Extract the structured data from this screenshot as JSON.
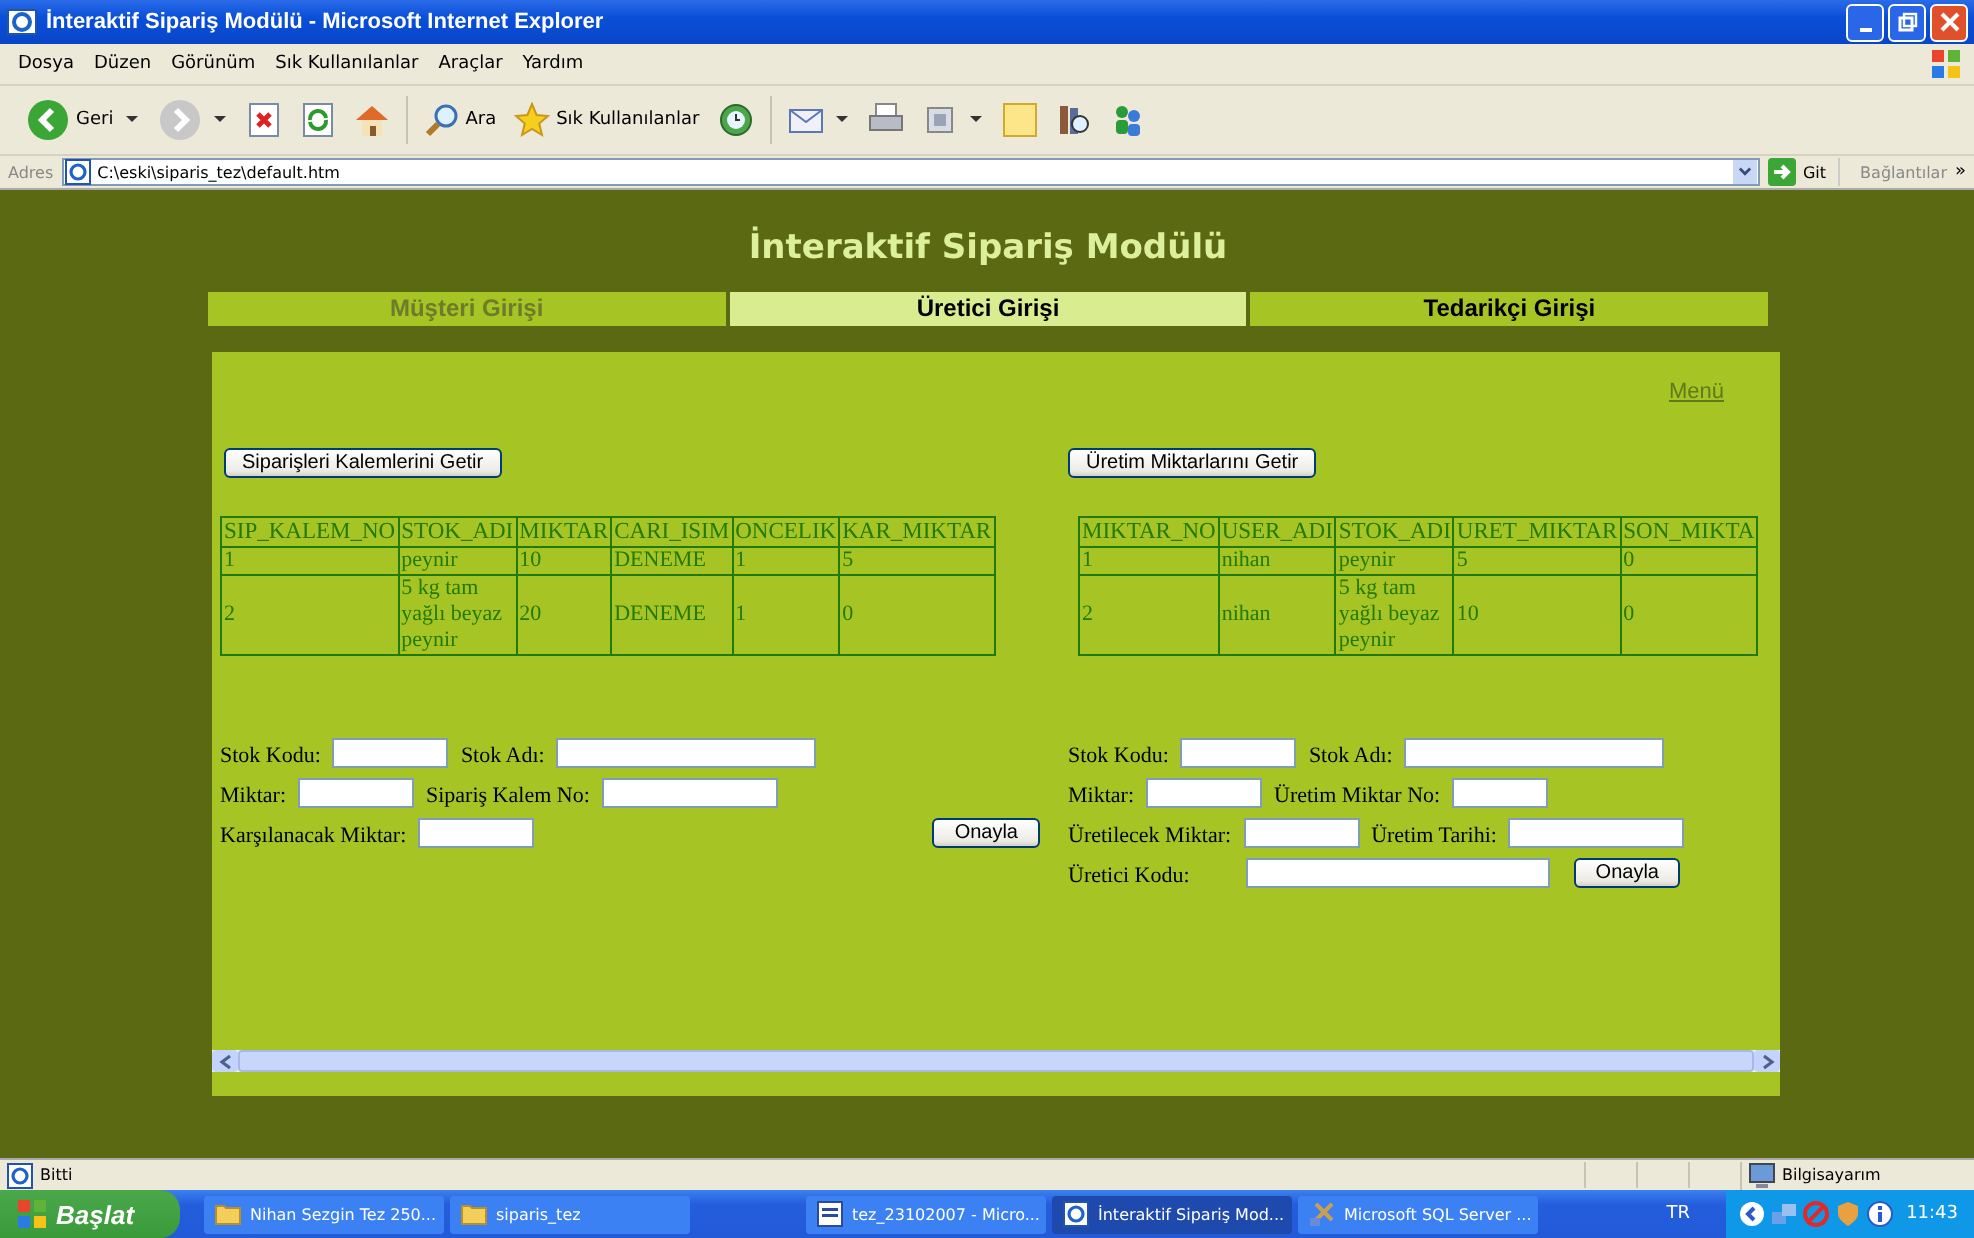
{
  "window": {
    "title": "İnteraktif Sipariş Modülü - Microsoft Internet Explorer"
  },
  "menu_bar": [
    "Dosya",
    "Düzen",
    "Görünüm",
    "Sık Kullanılanlar",
    "Araçlar",
    "Yardım"
  ],
  "toolbar": [
    {
      "kind": "back",
      "label": "Geri"
    },
    {
      "kind": "forward"
    },
    {
      "kind": "stop"
    },
    {
      "kind": "refresh"
    },
    {
      "kind": "home"
    },
    {
      "kind": "search",
      "label": "Ara"
    },
    {
      "kind": "favorites",
      "label": "Sık Kullanılanlar"
    },
    {
      "kind": "history"
    },
    {
      "kind": "mail"
    },
    {
      "kind": "print"
    },
    {
      "kind": "edit"
    },
    {
      "kind": "note"
    },
    {
      "kind": "research"
    },
    {
      "kind": "messenger"
    }
  ],
  "address_bar": {
    "label": "Adres",
    "value": "C:\\eski\\siparis_tez\\default.htm",
    "go": "Git",
    "links": "Bağlantılar",
    "more": "»"
  },
  "page": {
    "heading": "İnteraktif Sipariş Modülü",
    "tabs": [
      {
        "label": "Müşteri Girişi",
        "selected": false,
        "disabled": true
      },
      {
        "label": "Üretici Girişi",
        "selected": true,
        "disabled": false
      },
      {
        "label": "Tedarikçi Girişi",
        "selected": false,
        "disabled": false
      }
    ],
    "menu_link": "Menü",
    "sections": [
      {
        "button": "Siparişleri Kalemlerini Getir",
        "table": {
          "columns": [
            "SIP_KALEM_NO",
            "STOK_ADI",
            "MIKTAR",
            "CARI_ISIM",
            "ONCELIK",
            "KAR_MIKTAR"
          ],
          "rows": [
            [
              "1",
              "peynir",
              "10",
              "DENEME",
              "1",
              "5"
            ],
            [
              "2",
              "5 kg tam yağlı beyaz peynir",
              "20",
              "DENEME",
              "1",
              "0"
            ]
          ]
        },
        "form": [
          [
            {
              "kind": "label",
              "text": "Stok Kodu:"
            },
            {
              "kind": "input-short"
            },
            {
              "kind": "label",
              "text": "Stok Adı:"
            },
            {
              "kind": "input-long"
            }
          ],
          [
            {
              "kind": "label",
              "text": "Miktar:"
            },
            {
              "kind": "input-short"
            },
            {
              "kind": "label",
              "text": "Sipariş Kalem No:"
            },
            {
              "kind": "input-medium"
            }
          ],
          [
            {
              "kind": "label",
              "text": "Karşılanacak Miktar:"
            },
            {
              "kind": "input-short"
            },
            {
              "kind": "button",
              "text": "Onayla"
            }
          ]
        ]
      },
      {
        "button": "Üretim Miktarlarını Getir",
        "table": {
          "columns": [
            "MIKTAR_NO",
            "USER_ADI",
            "STOK_ADI",
            "URET_MIKTAR",
            "SON_MIKTA"
          ],
          "rows": [
            [
              "1",
              "nihan",
              "peynir",
              "5",
              "0"
            ],
            [
              "2",
              "nihan",
              "5 kg tam yağlı beyaz peynir",
              "10",
              "0"
            ]
          ]
        },
        "form": [
          [
            {
              "kind": "label",
              "text": "Stok Kodu:"
            },
            {
              "kind": "input-short"
            },
            {
              "kind": "label",
              "text": "Stok Adı:"
            },
            {
              "kind": "input-long"
            }
          ],
          [
            {
              "kind": "label",
              "text": "Miktar:"
            },
            {
              "kind": "input-short"
            },
            {
              "kind": "label",
              "text": "Üretim Miktar No:"
            },
            {
              "kind": "input-small"
            }
          ],
          [
            {
              "kind": "label",
              "text": "Üretilecek Miktar:"
            },
            {
              "kind": "input-short"
            },
            {
              "kind": "label",
              "text": "Üretim Tarihi:"
            },
            {
              "kind": "input-medium"
            }
          ],
          [
            {
              "kind": "label",
              "text": "Üretici Kodu:"
            },
            {
              "kind": "input-wide"
            },
            {
              "kind": "button",
              "text": "Onayla"
            }
          ]
        ]
      }
    ]
  },
  "status_bar": {
    "text": "Bitti",
    "zone": "Bilgisayarım"
  },
  "taskbar": {
    "start": "Başlat",
    "tasks": [
      {
        "kind": "folder",
        "label": "Nihan Sezgin Tez 250...",
        "selected": false
      },
      {
        "kind": "folder",
        "label": "siparis_tez",
        "selected": false
      },
      {
        "kind": "document",
        "label": "tez_23102007 - Micro...",
        "selected": false
      },
      {
        "kind": "browser",
        "label": "İnteraktif Sipariş Mod...",
        "selected": true
      },
      {
        "kind": "database",
        "label": "Microsoft SQL Server ...",
        "selected": false
      }
    ],
    "language": "TR",
    "clock": "11:43"
  }
}
